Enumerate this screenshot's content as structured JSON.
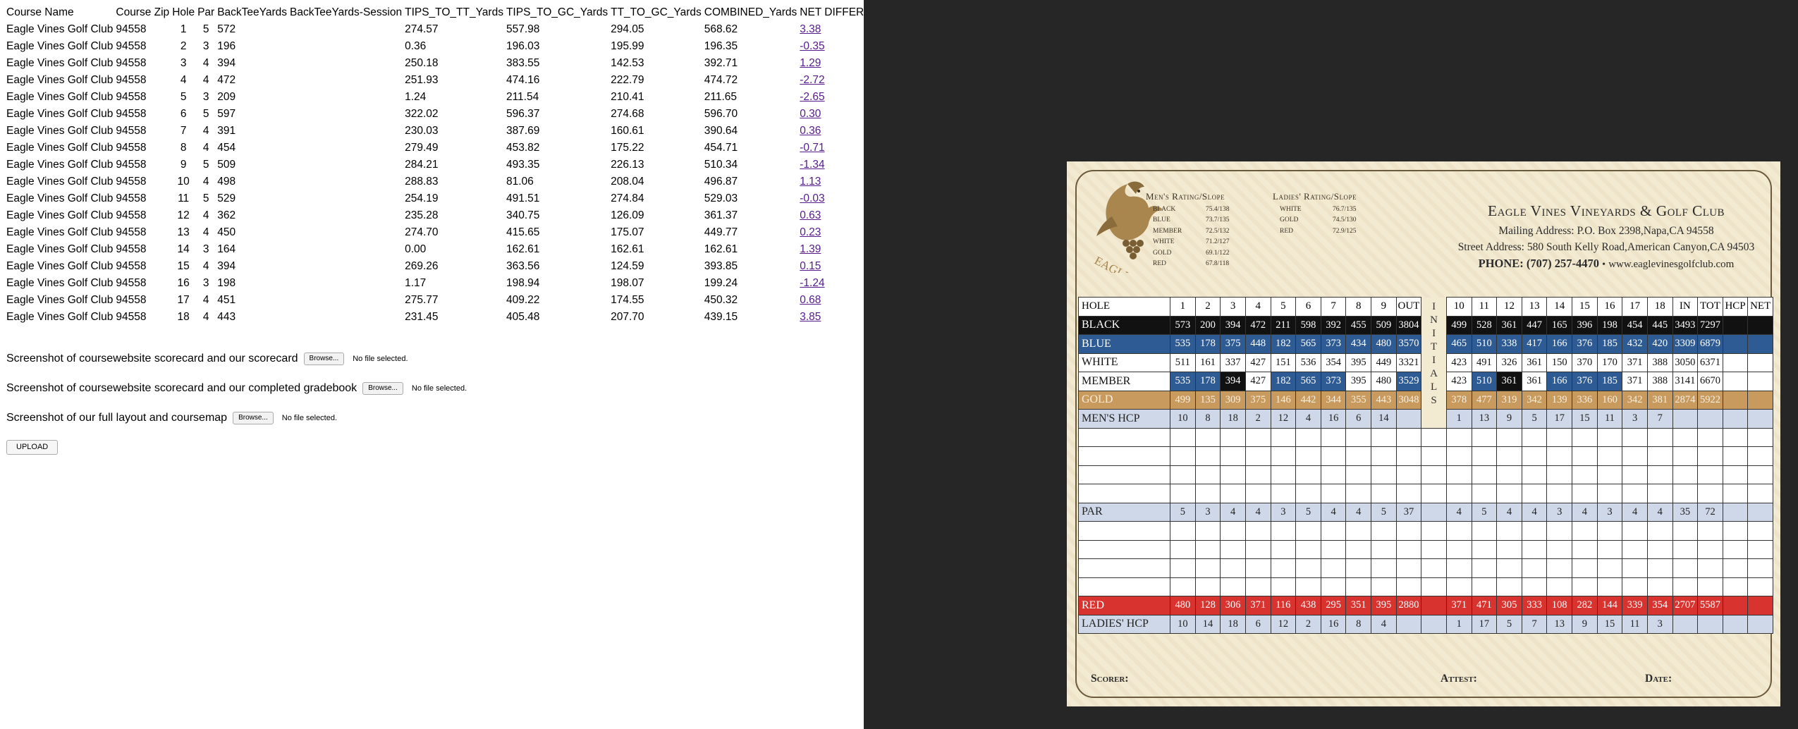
{
  "table": {
    "headers": [
      "Course Name",
      "Course Zip",
      "Hole",
      "Par",
      "BackTeeYards",
      "BackTeeYards-Session",
      "TIPS_TO_TT_Yards",
      "TIPS_TO_GC_Yards",
      "TT_TO_GC_Yards",
      "COMBINED_Yards",
      "NET DIFFERENCE"
    ],
    "rows": [
      [
        "Eagle Vines Golf Club",
        "94558",
        "1",
        "5",
        "572",
        "",
        "274.57",
        "557.98",
        "294.05",
        "568.62",
        "3.38"
      ],
      [
        "Eagle Vines Golf Club",
        "94558",
        "2",
        "3",
        "196",
        "",
        "0.36",
        "196.03",
        "195.99",
        "196.35",
        "-0.35"
      ],
      [
        "Eagle Vines Golf Club",
        "94558",
        "3",
        "4",
        "394",
        "",
        "250.18",
        "383.55",
        "142.53",
        "392.71",
        "1.29"
      ],
      [
        "Eagle Vines Golf Club",
        "94558",
        "4",
        "4",
        "472",
        "",
        "251.93",
        "474.16",
        "222.79",
        "474.72",
        "-2.72"
      ],
      [
        "Eagle Vines Golf Club",
        "94558",
        "5",
        "3",
        "209",
        "",
        "1.24",
        "211.54",
        "210.41",
        "211.65",
        "-2.65"
      ],
      [
        "Eagle Vines Golf Club",
        "94558",
        "6",
        "5",
        "597",
        "",
        "322.02",
        "596.37",
        "274.68",
        "596.70",
        "0.30"
      ],
      [
        "Eagle Vines Golf Club",
        "94558",
        "7",
        "4",
        "391",
        "",
        "230.03",
        "387.69",
        "160.61",
        "390.64",
        "0.36"
      ],
      [
        "Eagle Vines Golf Club",
        "94558",
        "8",
        "4",
        "454",
        "",
        "279.49",
        "453.82",
        "175.22",
        "454.71",
        "-0.71"
      ],
      [
        "Eagle Vines Golf Club",
        "94558",
        "9",
        "5",
        "509",
        "",
        "284.21",
        "493.35",
        "226.13",
        "510.34",
        "-1.34"
      ],
      [
        "Eagle Vines Golf Club",
        "94558",
        "10",
        "4",
        "498",
        "",
        "288.83",
        "81.06",
        "208.04",
        "496.87",
        "1.13"
      ],
      [
        "Eagle Vines Golf Club",
        "94558",
        "11",
        "5",
        "529",
        "",
        "254.19",
        "491.51",
        "274.84",
        "529.03",
        "-0.03"
      ],
      [
        "Eagle Vines Golf Club",
        "94558",
        "12",
        "4",
        "362",
        "",
        "235.28",
        "340.75",
        "126.09",
        "361.37",
        "0.63"
      ],
      [
        "Eagle Vines Golf Club",
        "94558",
        "13",
        "4",
        "450",
        "",
        "274.70",
        "415.65",
        "175.07",
        "449.77",
        "0.23"
      ],
      [
        "Eagle Vines Golf Club",
        "94558",
        "14",
        "3",
        "164",
        "",
        "0.00",
        "162.61",
        "162.61",
        "162.61",
        "1.39"
      ],
      [
        "Eagle Vines Golf Club",
        "94558",
        "15",
        "4",
        "394",
        "",
        "269.26",
        "363.56",
        "124.59",
        "393.85",
        "0.15"
      ],
      [
        "Eagle Vines Golf Club",
        "94558",
        "16",
        "3",
        "198",
        "",
        "1.17",
        "198.94",
        "198.07",
        "199.24",
        "-1.24"
      ],
      [
        "Eagle Vines Golf Club",
        "94558",
        "17",
        "4",
        "451",
        "",
        "275.77",
        "409.22",
        "174.55",
        "450.32",
        "0.68"
      ],
      [
        "Eagle Vines Golf Club",
        "94558",
        "18",
        "4",
        "443",
        "",
        "231.45",
        "405.48",
        "207.70",
        "439.15",
        "3.85"
      ]
    ]
  },
  "uploads": [
    {
      "label": "Screenshot of coursewebsite scorecard and our scorecard",
      "button": "Browse...",
      "status": "No file selected."
    },
    {
      "label": "Screenshot of coursewebsite scorecard and our completed gradebook",
      "button": "Browse...",
      "status": "No file selected."
    },
    {
      "label": "Screenshot of our full layout and coursemap",
      "button": "Browse...",
      "status": "No file selected."
    }
  ],
  "upload_button": "UPLOAD",
  "scorecard": {
    "logo_text": "EAGLE VINES",
    "mens_title": "Men's Rating/Slope",
    "mens": [
      [
        "BLACK",
        "75.4/138"
      ],
      [
        "BLUE",
        "73.7/135"
      ],
      [
        "MEMBER",
        "72.5/132"
      ],
      [
        "WHITE",
        "71.2/127"
      ],
      [
        "GOLD",
        "69.1/122"
      ],
      [
        "RED",
        "67.8/118"
      ]
    ],
    "ladies_title": "Ladies' Rating/Slope",
    "ladies": [
      [
        "WHITE",
        "76.7/135"
      ],
      [
        "GOLD",
        "74.5/130"
      ],
      [
        "RED",
        "72.9/125"
      ]
    ],
    "club_name": "Eagle Vines Vineyards & Golf Club",
    "mailing": "Mailing Address: P.O. Box 2398,Napa,CA 94558",
    "street": "Street Address: 580 South Kelly Road,American Canyon,CA 94503",
    "phone": "PHONE: (707) 257-4470",
    "website": "www.eaglevinesgolfclub.com",
    "initials": [
      "I",
      "N",
      "I",
      "T",
      "I",
      "A",
      "L",
      "S"
    ],
    "rows": {
      "hole": {
        "label": "HOLE",
        "front": [
          "1",
          "2",
          "3",
          "4",
          "5",
          "6",
          "7",
          "8",
          "9",
          "OUT"
        ],
        "back": [
          "10",
          "11",
          "12",
          "13",
          "14",
          "15",
          "16",
          "17",
          "18",
          "IN",
          "TOT",
          "HCP",
          "NET"
        ]
      },
      "black": {
        "label": "BLACK",
        "front": [
          "573",
          "200",
          "394",
          "472",
          "211",
          "598",
          "392",
          "455",
          "509",
          "3804"
        ],
        "back": [
          "499",
          "528",
          "361",
          "447",
          "165",
          "396",
          "198",
          "454",
          "445",
          "3493",
          "7297",
          "",
          ""
        ]
      },
      "blue": {
        "label": "BLUE",
        "front": [
          "535",
          "178",
          "375",
          "448",
          "182",
          "565",
          "373",
          "434",
          "480",
          "3570"
        ],
        "back": [
          "465",
          "510",
          "338",
          "417",
          "166",
          "376",
          "185",
          "432",
          "420",
          "3309",
          "6879",
          "",
          ""
        ]
      },
      "white": {
        "label": "WHITE",
        "front": [
          "511",
          "161",
          "337",
          "427",
          "151",
          "536",
          "354",
          "395",
          "449",
          "3321"
        ],
        "back": [
          "423",
          "491",
          "326",
          "361",
          "150",
          "370",
          "170",
          "371",
          "388",
          "3050",
          "6371",
          "",
          ""
        ]
      },
      "member": {
        "label": "MEMBER",
        "front": [
          "535",
          "178",
          "394",
          "427",
          "182",
          "565",
          "373",
          "395",
          "480",
          "3529"
        ],
        "back": [
          "423",
          "510",
          "361",
          "361",
          "166",
          "376",
          "185",
          "371",
          "388",
          "3141",
          "6670",
          "",
          ""
        ]
      },
      "gold": {
        "label": "GOLD",
        "front": [
          "499",
          "135",
          "309",
          "375",
          "146",
          "442",
          "344",
          "355",
          "443",
          "3048"
        ],
        "back": [
          "378",
          "477",
          "319",
          "342",
          "139",
          "336",
          "160",
          "342",
          "381",
          "2874",
          "5922",
          "",
          ""
        ]
      },
      "mens_hcp": {
        "label": "MEN'S HCP",
        "front": [
          "10",
          "8",
          "18",
          "2",
          "12",
          "4",
          "16",
          "6",
          "14",
          ""
        ],
        "back": [
          "1",
          "13",
          "9",
          "5",
          "17",
          "15",
          "11",
          "3",
          "7",
          "",
          "",
          "",
          ""
        ]
      },
      "par": {
        "label": "PAR",
        "front": [
          "5",
          "3",
          "4",
          "4",
          "3",
          "5",
          "4",
          "4",
          "5",
          "37"
        ],
        "back": [
          "4",
          "5",
          "4",
          "4",
          "3",
          "4",
          "3",
          "4",
          "4",
          "35",
          "72",
          "",
          ""
        ]
      },
      "red": {
        "label": "RED",
        "front": [
          "480",
          "128",
          "306",
          "371",
          "116",
          "438",
          "295",
          "351",
          "395",
          "2880"
        ],
        "back": [
          "371",
          "471",
          "305",
          "333",
          "108",
          "282",
          "144",
          "339",
          "354",
          "2707",
          "5587",
          "",
          ""
        ]
      },
      "ladies_hcp": {
        "label": "LADIES' HCP",
        "front": [
          "10",
          "14",
          "18",
          "6",
          "12",
          "2",
          "16",
          "8",
          "4",
          ""
        ],
        "back": [
          "1",
          "17",
          "5",
          "7",
          "13",
          "9",
          "15",
          "11",
          "3",
          "",
          "",
          "",
          ""
        ]
      }
    },
    "scorer": "Scorer:",
    "attest": "Attest:",
    "date": "Date:"
  }
}
